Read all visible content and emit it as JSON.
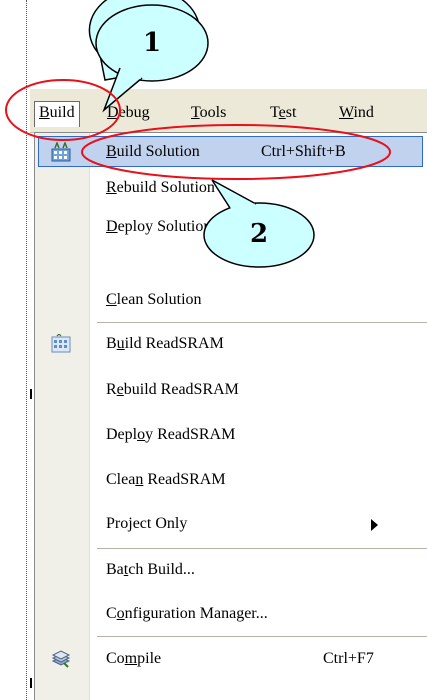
{
  "menubar": {
    "items": [
      {
        "label": "Build",
        "underline_index": 0,
        "active": true
      },
      {
        "label": "Debug",
        "underline_index": 0,
        "active": false
      },
      {
        "label": "Tools",
        "underline_index": 0,
        "active": false
      },
      {
        "label": "Test",
        "underline_index": 1,
        "active": false
      },
      {
        "label": "Wind",
        "underline_index": 0,
        "active": false
      }
    ]
  },
  "menu": {
    "items": [
      {
        "label_pre": "",
        "label_key": "B",
        "label_post": "uild Solution",
        "shortcut": "Ctrl+Shift+B",
        "icon": "build-solution-icon"
      },
      {
        "label_pre": "",
        "label_key": "R",
        "label_post": "ebuild Solution",
        "shortcut": ""
      },
      {
        "label_pre": "",
        "label_key": "D",
        "label_post": "eploy Solution",
        "shortcut": ""
      },
      {
        "label_pre": "",
        "label_key": "C",
        "label_post": "lean Solution",
        "shortcut": ""
      },
      {
        "label_pre": "B",
        "label_key": "u",
        "label_post": "ild ReadSRAM",
        "shortcut": "",
        "icon": "build-project-icon"
      },
      {
        "label_pre": "R",
        "label_key": "e",
        "label_post": "build ReadSRAM",
        "shortcut": ""
      },
      {
        "label_pre": "Depl",
        "label_key": "o",
        "label_post": "y ReadSRAM",
        "shortcut": ""
      },
      {
        "label_pre": "Clea",
        "label_key": "n",
        "label_post": " ReadSRAM",
        "shortcut": ""
      },
      {
        "label_pre": "Pro",
        "label_key": "j",
        "label_post": "ect Only",
        "shortcut": "",
        "submenu": true
      },
      {
        "label_pre": "Ba",
        "label_key": "t",
        "label_post": "ch Build...",
        "shortcut": ""
      },
      {
        "label_pre": "C",
        "label_key": "o",
        "label_post": "nfiguration Manager...",
        "shortcut": ""
      },
      {
        "label_pre": "Co",
        "label_key": "m",
        "label_post": "pile",
        "shortcut": "Ctrl+F7",
        "icon": "compile-icon"
      }
    ]
  },
  "annotations": {
    "callout_1": "1",
    "callout_2": "2",
    "callout_fill": "#ccffff",
    "ellipse_color": "#e8101a"
  },
  "colors": {
    "menubar_bg": "#ece9d8",
    "highlight_bg": "#c1d2ee",
    "highlight_border": "#316ac5"
  }
}
